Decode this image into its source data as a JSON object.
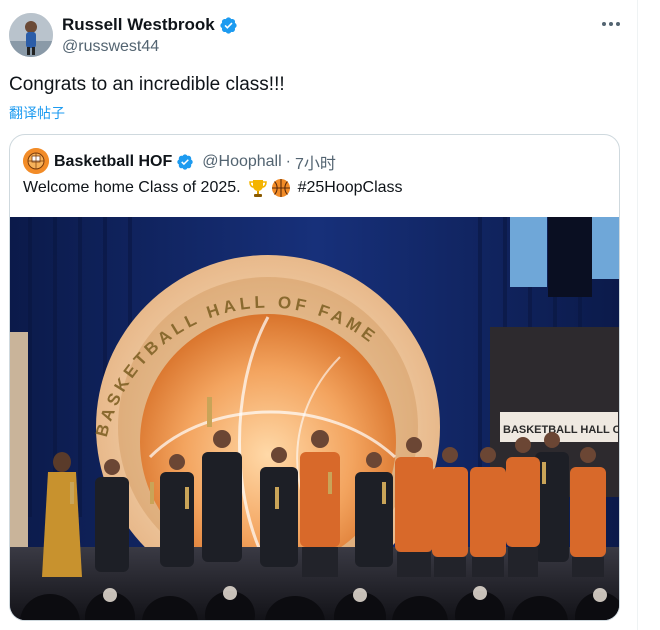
{
  "tweet": {
    "author_name": "Russell Westbrook",
    "author_handle": "@russwest44",
    "text": "Congrats to an incredible class!!!",
    "translate_label": "翻译帖子",
    "more_icon": "more-horizontal-icon",
    "verified_icon": "verified-badge-icon"
  },
  "quote": {
    "author_name": "Basketball HOF",
    "author_handle": "@Hoophall",
    "separator": "·",
    "time": "7小时",
    "text": "Welcome home Class of 2025.",
    "emojis": [
      "trophy-emoji",
      "basketball-emoji"
    ],
    "hashtag": "#25HoopClass",
    "image": {
      "description_icon": "hall-of-fame-ceremony-photo",
      "seal_text": "BASKETBALL HALL OF FAME",
      "banner_text": "BASKETBALL HALL OF FA"
    }
  },
  "colors": {
    "link": "#1d9bf0",
    "secondary_text": "#536471",
    "verified": "#1d9bf0",
    "border": "#cfd9de"
  }
}
